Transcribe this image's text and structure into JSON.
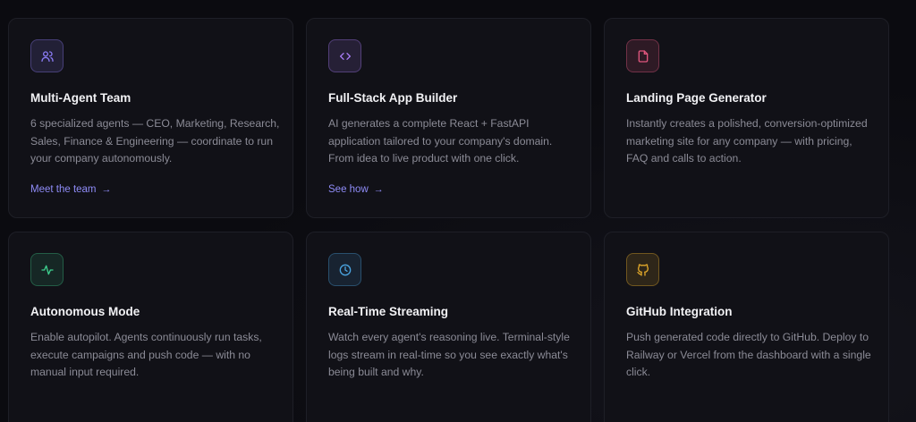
{
  "cards": [
    {
      "icon": "users-icon",
      "color": "#8b7cf6",
      "title": "Multi-Agent Team",
      "desc": "6 specialized agents — CEO, Marketing, Research, Sales, Finance & Engineering — coordinate to run your company autonomously.",
      "link": "Meet the team"
    },
    {
      "icon": "code-icon",
      "color": "#a77cf6",
      "title": "Full-Stack App Builder",
      "desc": "AI generates a complete React + FastAPI application tailored to your company's domain. From idea to live product with one click.",
      "link": "See how"
    },
    {
      "icon": "document-icon",
      "color": "#e0567e",
      "title": "Landing Page Generator",
      "desc": "Instantly creates a polished, conversion-optimized marketing site for any company — with pricing, FAQ and calls to action."
    },
    {
      "icon": "activity-icon",
      "color": "#3ecf8e",
      "title": "Autonomous Mode",
      "desc": "Enable autopilot. Agents continuously run tasks, execute campaigns and push code — with no manual input required."
    },
    {
      "icon": "clock-icon",
      "color": "#4aa3df",
      "title": "Real-Time Streaming",
      "desc": "Watch every agent's reasoning live. Terminal-style logs stream in real-time so you see exactly what's being built and why."
    },
    {
      "icon": "github-icon",
      "color": "#e0a72a",
      "title": "GitHub Integration",
      "desc": "Push generated code directly to GitHub. Deploy to Railway or Vercel from the dashboard with a single click."
    }
  ],
  "link_arrow": "→",
  "link_color": "#8f8cf7"
}
